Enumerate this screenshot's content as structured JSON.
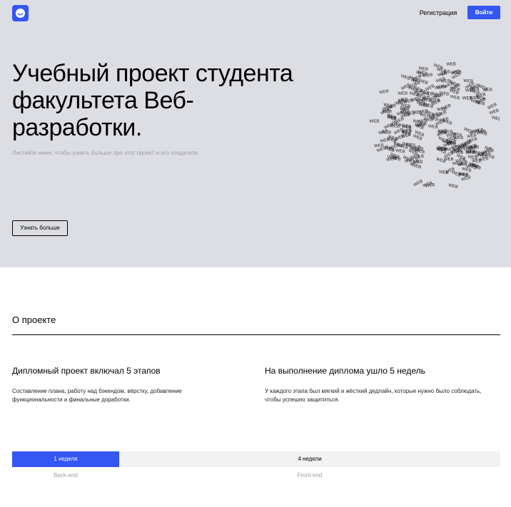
{
  "header": {
    "register_label": "Регистрация",
    "login_label": "Войти",
    "accent_color": "#3456f3"
  },
  "hero": {
    "title": "Учебный проект студента факультета Веб-разработки.",
    "subtitle": "Листайте ниже, чтобы узнать больше про этот проект и его создателя.",
    "button_label": "Узнать больше",
    "globe_word": "WEB",
    "background_color": "#dddee3"
  },
  "about": {
    "title": "О проекте",
    "left": {
      "heading": "Дипломный проект включал 5 этапов",
      "text": "Составление плана, работу над бэкендом, вёрстку, добавление функциональности и финальные доработки."
    },
    "right": {
      "heading": "На выполнение диплома ушло 5 недель",
      "text": "У каждого этапа был мягкий и жёсткий дедлайн, которые нужно было соблюдать, чтобы успешно защититься."
    }
  },
  "timeline": {
    "backend": {
      "duration": "1 неделя",
      "label": "Back-end",
      "weeks": 1
    },
    "frontend": {
      "duration": "4 недели",
      "label": "Front-end",
      "weeks": 4
    }
  }
}
